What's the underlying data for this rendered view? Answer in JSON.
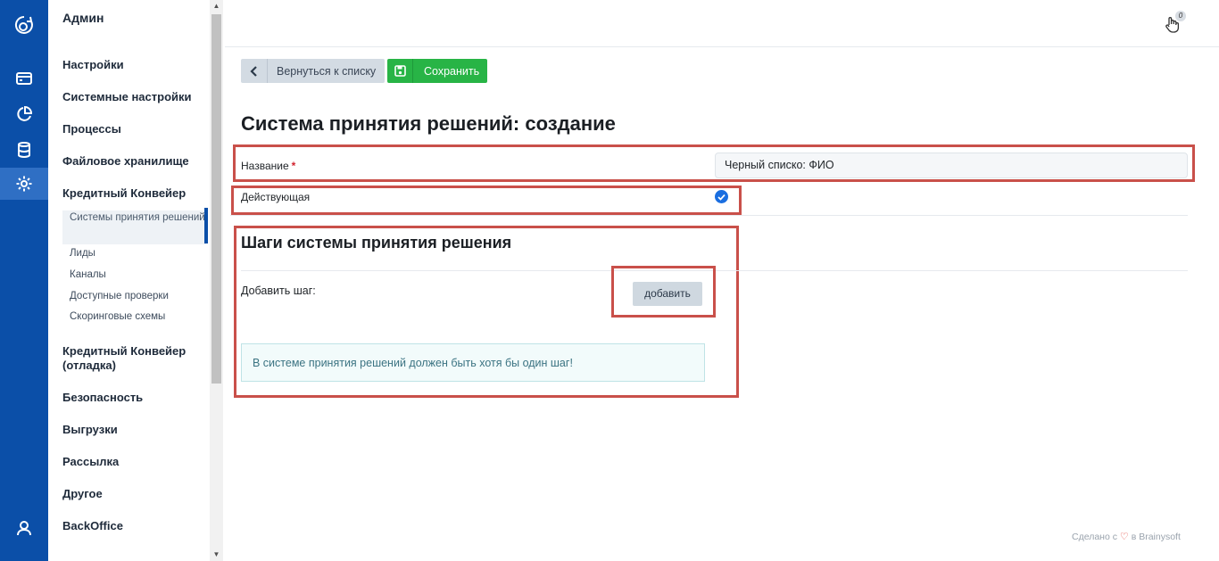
{
  "rail": {
    "icons": [
      "logo-icon",
      "card-icon",
      "pie-chart-icon",
      "database-icon",
      "gear-icon",
      "user-icon"
    ]
  },
  "sidebar": {
    "title": "Админ",
    "items": [
      {
        "label": "Настройки"
      },
      {
        "label": "Системные настройки"
      },
      {
        "label": "Процессы"
      },
      {
        "label": "Файловое хранилище"
      },
      {
        "label": "Кредитный Конвейер"
      }
    ],
    "subitems": [
      {
        "label": "Системы принятия решений",
        "active": true
      },
      {
        "label": "Лиды"
      },
      {
        "label": "Каналы"
      },
      {
        "label": "Доступные проверки"
      },
      {
        "label": "Скоринговые схемы"
      }
    ],
    "items_after": [
      {
        "label": "Кредитный Конвейер (отладка)"
      },
      {
        "label": "Безопасность"
      },
      {
        "label": "Выгрузки"
      },
      {
        "label": "Рассылка"
      },
      {
        "label": "Другое"
      },
      {
        "label": "BackOffice"
      }
    ]
  },
  "topbar": {
    "hand_badge": "0"
  },
  "toolbar": {
    "back_label": "Вернуться к списку",
    "save_label": "Сохранить"
  },
  "page": {
    "title": "Система принятия решений: создание"
  },
  "form": {
    "name_label": "Название",
    "name_required": "*",
    "name_value": "Черный списко: ФИО",
    "active_label": "Действующая",
    "active_checked": true
  },
  "steps": {
    "title": "Шаги системы принятия решения",
    "add_label": "Добавить шаг:",
    "add_button": "добавить",
    "alert": "В системе принятия решений должен быть хотя бы один шаг!"
  },
  "footer": {
    "made_with": "Сделано с",
    "in_text": "в Brainysoft"
  },
  "colors": {
    "rail": "#0b4fa8",
    "save": "#28b446",
    "highlight": "#c9504a"
  }
}
